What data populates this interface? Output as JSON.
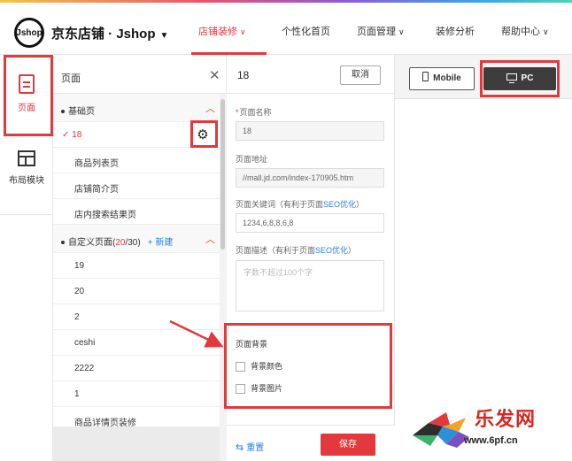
{
  "header": {
    "logo_text": "Jshop",
    "shop_name": "京东店铺 · Jshop",
    "shop_caret": "▼",
    "nav": [
      {
        "label": "店铺装修",
        "chevron": "∨",
        "active": true
      },
      {
        "label": "个性化首页",
        "chevron": "",
        "active": false
      },
      {
        "label": "页面管理",
        "chevron": "∨",
        "active": false
      },
      {
        "label": "装修分析",
        "chevron": "",
        "active": false
      },
      {
        "label": "帮助中心",
        "chevron": "∨",
        "active": false
      }
    ]
  },
  "rail": {
    "items": [
      {
        "label": "页面",
        "icon": "page-icon",
        "active": true
      },
      {
        "label": "布局模块",
        "icon": "layout-icon",
        "active": false
      }
    ]
  },
  "page_list": {
    "title": "页面",
    "close_icon": "✕",
    "basic_section": {
      "label": "基础页",
      "toggle": "︿"
    },
    "basic_pages": [
      {
        "label": "18",
        "selected": true,
        "check": "✓"
      },
      {
        "label": "商品列表页"
      },
      {
        "label": "店铺简介页"
      },
      {
        "label": "店内搜索结果页"
      }
    ],
    "custom_section": {
      "label_prefix": "自定义页面(",
      "count": "20",
      "label_suffix": "/30)",
      "new_label": "+ 新建",
      "toggle": "︿"
    },
    "custom_pages": [
      "19",
      "20",
      "2",
      "ceshi",
      "2222",
      "1",
      "商品详情页装修"
    ],
    "gear_icon": "⚙"
  },
  "settings": {
    "page_name_header": "18",
    "cancel_label": "取消",
    "name_label": "页面名称",
    "name_required_mark": "*",
    "name_value": "18",
    "url_label": "页面地址",
    "url_value": "//mall.jd.com/index-170905.htm",
    "keywords_label": "页面关键词（有利于页面",
    "keywords_seo": "SEO优化",
    "keywords_close": "）",
    "keywords_value": "1234,6,8,8,6,8",
    "desc_label": "页面描述（有利于页面",
    "desc_seo": "SEO优化",
    "desc_close": "）",
    "desc_placeholder": "字数不超过100个字",
    "background_label": "页面背景",
    "bg_color_label": "背景颜色",
    "bg_image_label": "背景图片",
    "reset_icon": "⇆",
    "reset_label": "重置",
    "save_label": "保存"
  },
  "preview": {
    "mobile_label": "Mobile",
    "pc_label": "PC",
    "selected_mode": "PC"
  },
  "watermark": {
    "cn": "乐发网",
    "url": "www.6pf.cn"
  },
  "colors": {
    "accent_red": "#e4393c",
    "link_blue": "#2b7fe0",
    "pc_button_bg": "#3d3d3d"
  }
}
